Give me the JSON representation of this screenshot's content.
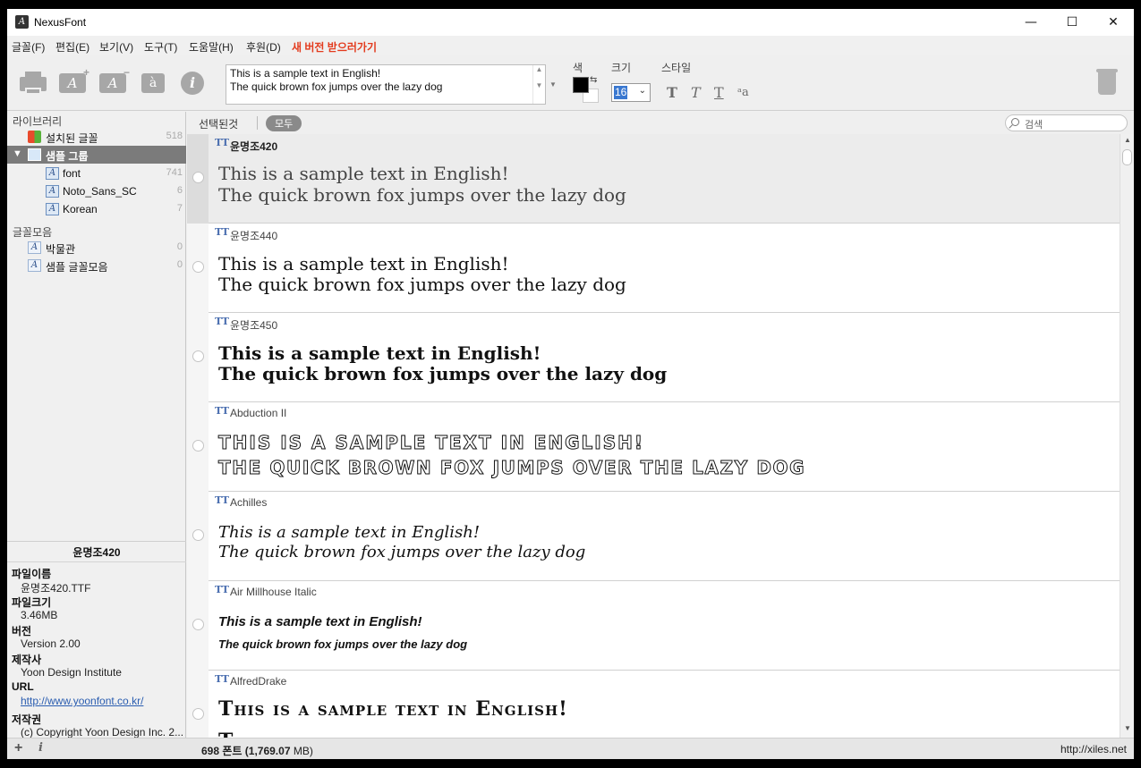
{
  "window": {
    "title": "NexusFont",
    "minimize": "—",
    "maximize": "☐",
    "close": "✕"
  },
  "menu": [
    "글꼴(F)",
    "편집(E)",
    "보기(V)",
    "도구(T)",
    "도움말(H)",
    "후원(D)"
  ],
  "menu_new": "새 버전 받으러가기",
  "toolbar": {
    "sample_line1": "This is a sample text in English!",
    "sample_line2": "The quick brown fox jumps over the lazy dog",
    "color_label": "색",
    "size_label": "크기",
    "style_label": "스타일",
    "size_value": "16",
    "style_bold": "T",
    "style_italic": "T",
    "style_underline": "T",
    "style_case": "ᵃa",
    "icon_font_glyph": "A",
    "icon_char_glyph": "à",
    "icon_info_glyph": "i",
    "icon_plus": "+",
    "icon_minus": "−"
  },
  "sidebar": {
    "library_header": "라이브러리",
    "installed": {
      "label": "설치된 글꼴",
      "count": "518"
    },
    "group": {
      "label": "샘플 그룹"
    },
    "group_items": [
      {
        "label": "font",
        "count": "741"
      },
      {
        "label": "Noto_Sans_SC",
        "count": "6"
      },
      {
        "label": "Korean",
        "count": "7"
      }
    ],
    "collections_header": "글꼴모음",
    "collections": [
      {
        "label": "박물관",
        "count": "0"
      },
      {
        "label": "샘플 글꼴모음",
        "count": "0"
      }
    ]
  },
  "info": {
    "title": "윤명조420",
    "filename_label": "파일이름",
    "filename": "윤명조420.TTF",
    "filesize_label": "파일크기",
    "filesize": "3.46MB",
    "version_label": "버전",
    "version": "Version 2.00",
    "maker_label": "제작사",
    "maker": "Yoon Design Institute",
    "url_label": "URL",
    "url": "http://www.yoonfont.co.kr/",
    "copyright_label": "저작권",
    "copyright": "(c) Copyright Yoon Design Inc. 2..."
  },
  "listbar": {
    "selected": "선택된것",
    "all": "모두",
    "search_placeholder": "검색"
  },
  "fonts": [
    {
      "name": "윤명조420",
      "line1": "This is a sample text in English!",
      "line2": "The quick brown fox jumps over the lazy dog"
    },
    {
      "name": "윤명조440",
      "line1": "This is a sample text in English!",
      "line2": "The quick brown fox jumps over the lazy dog"
    },
    {
      "name": "윤명조450",
      "line1": "This is a sample text in English!",
      "line2": "The quick brown fox jumps over the lazy dog"
    },
    {
      "name": "Abduction II",
      "line1": "This is a sample text in English!",
      "line2": "The quick brown fox jumps over the lazy dog"
    },
    {
      "name": "Achilles",
      "line1": "This is a sample text in English!",
      "line2": "The quick brown fox jumps over the lazy dog"
    },
    {
      "name": "Air Millhouse Italic",
      "line1": "This is a sample text in English!",
      "line2": "The quick brown fox jumps over the lazy dog"
    },
    {
      "name": "AlfredDrake",
      "line1": "This is a sample text in English!",
      "line2": "The quick brown fox jumps over the lazy dog"
    }
  ],
  "tt_glyph": "TT",
  "status": {
    "count_prefix": "698 폰트 (",
    "count_bold": "1,769.07",
    "count_suffix": " MB)",
    "url": "http://xiles.net",
    "add": "+",
    "info": "i"
  }
}
